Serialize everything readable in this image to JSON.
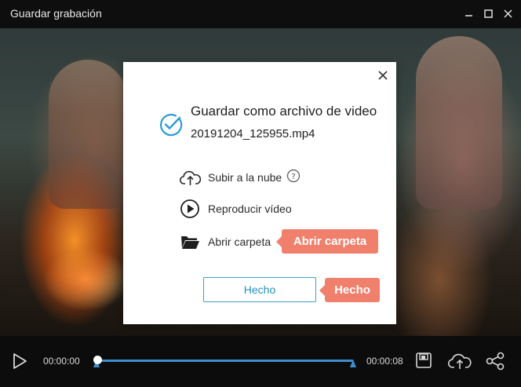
{
  "window": {
    "title": "Guardar grabación",
    "buttons": [
      "minimize-icon",
      "maximize-icon",
      "close-icon"
    ]
  },
  "dialog": {
    "title": "Guardar como archivo de video",
    "filename": "20191204_125955.mp4",
    "actions": [
      {
        "label": "Subir a la nube",
        "icon": "cloud-upload-icon",
        "has_help": true
      },
      {
        "label": "Reproducir vídeo",
        "icon": "play-circle-icon",
        "has_help": false
      },
      {
        "label": "Abrir carpeta",
        "icon": "folder-icon",
        "has_help": false
      }
    ],
    "done_label": "Hecho"
  },
  "callouts": {
    "open_folder": "Abrir carpeta",
    "done": "Hecho"
  },
  "player": {
    "current_time": "00:00:00",
    "total_time": "00:00:08",
    "progress": 0
  },
  "colors": {
    "accent": "#3d8fd0",
    "callout": "#f0806c",
    "button_text": "#2490c4",
    "check": "#2a9bd8"
  }
}
